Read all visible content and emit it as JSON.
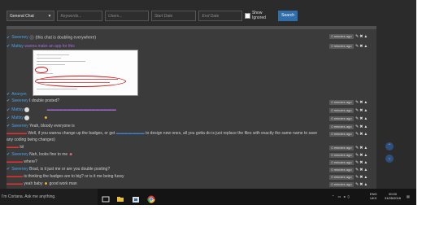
{
  "filters": {
    "channel": "General Chat",
    "keywords_placeholder": "Keywords...",
    "users_placeholder": "Users...",
    "start_date_placeholder": "Start Date",
    "end_date_placeholder": "End Date",
    "show_ignored_label": "Show Ignored",
    "search_label": "Search"
  },
  "messages": [
    {
      "user": "Sweeney",
      "text": "this chat is doubling everywhere",
      "time": "0 minutes ago"
    },
    {
      "user": "Mattsy",
      "text": "wanna make an app for this",
      "time": "0 minutes ago"
    },
    {
      "user": "Sweeney",
      "text": "I double posted?",
      "time": "0 minutes ago"
    },
    {
      "user": "Mattsy",
      "text": "",
      "time": "0 minutes ago"
    },
    {
      "user": "Mattsy",
      "text": "",
      "time": "0 minutes ago"
    },
    {
      "user": "Sweeney",
      "text": "Yeah, bloody everyone is",
      "time": "0 minutes ago"
    },
    {
      "user": "",
      "text": "Well, if you wanna change up the badges, or get",
      "text2": "to design new ones, all you gotta do is just replace the files with exactly the same name to save",
      "text3": "any coding being changes)",
      "time": "0 minutes ago"
    },
    {
      "user": "",
      "text": "lol",
      "time": "0 minutes ago"
    },
    {
      "user": "Sweeney",
      "text": "Nah, looks fine to me",
      "time": "0 minutes ago"
    },
    {
      "user": "",
      "text": "where?",
      "time": "0 minutes ago"
    },
    {
      "user": "Sweeney",
      "text": "Brad, is it just me or are you double posting?",
      "time": "0 minutes ago"
    },
    {
      "user": "",
      "text": "is thinking the badges are to big? or is it me being fussy",
      "time": "0 minutes ago"
    },
    {
      "user": "",
      "text": "yeah baby",
      "text2": "good work man",
      "time": "0 minutes ago"
    }
  ],
  "taskbar": {
    "cortana": "I'm Cortana. Ask me anything.",
    "lang": "ENG",
    "region": "UKX",
    "time": "00:00",
    "date": "31/05/2016"
  }
}
